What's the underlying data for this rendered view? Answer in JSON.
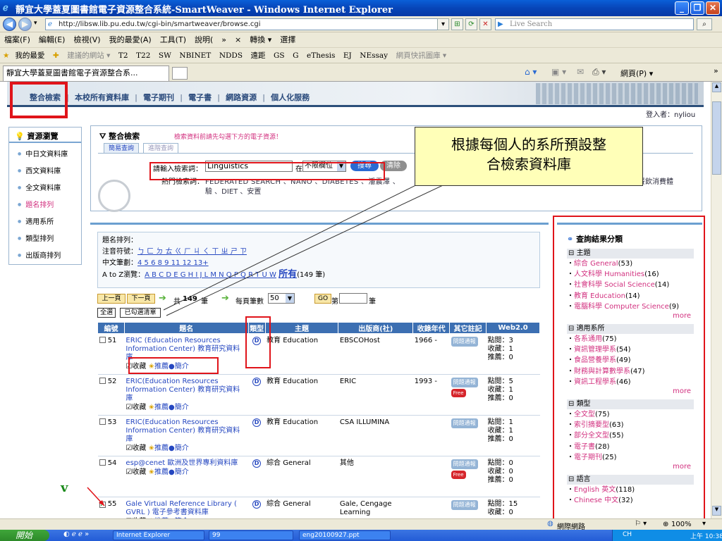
{
  "window": {
    "title": "靜宜大學蓋夏圖書館電子資源整合系統-SmartWeaver - Windows Internet Explorer"
  },
  "address": {
    "url": "http://libsw.lib.pu.edu.tw/cgi-bin/smartweaver/browse.cgi",
    "search_placeholder": "Live Search"
  },
  "menu": [
    "檔案(F)",
    "編輯(E)",
    "檢視(V)",
    "我的最愛(A)",
    "工具(T)",
    "說明(",
    "»",
    "×",
    "轉換 ▾",
    "選擇"
  ],
  "favorites": {
    "label": "我的最愛",
    "items": [
      "建議的網站 ▾",
      "T2",
      "T22",
      "SW",
      "NBINET",
      "NDDS",
      "遠距",
      "GS",
      "G",
      "eThesis",
      "EJ",
      "NEssay",
      "網頁快訊圖庫 ▾"
    ]
  },
  "tab": {
    "title": "靜宜大學蓋夏圖書館電子資源整合系...",
    "page_menu": "網頁(P) ▾"
  },
  "topnav": [
    "整合檢索",
    "本校所有資料庫",
    "電子期刊",
    "電子書",
    "網路資源",
    "個人化服務"
  ],
  "login": "登入者：nyliou",
  "sidebar": {
    "title": "資源瀏覽",
    "items": [
      "中日文資料庫",
      "西文資料庫",
      "全文資料庫",
      "題名排列",
      "適用系所",
      "類型排列",
      "出版商排列"
    ]
  },
  "searchpanel": {
    "title": "整合檢索",
    "notice": "檢索資料前請先勾選下方的電子資源！",
    "tabs": [
      "簡易查詢",
      "進階查詢"
    ],
    "input_label": "請輸入檢索詞：",
    "input_value": "Linguistics",
    "in_label": "在",
    "field_select": "不限欄位",
    "search_btn": "搜尋",
    "clear_btn": "清除",
    "hot_label": "熱門檢索詞：",
    "hot_terms": "FEDERATED SEARCH 、NANO 、DIABETES 、潘震澤 、",
    "hot_terms2": "驗 、DIET 、安置",
    "hot_right": "餐飲消費體"
  },
  "criteria": {
    "heading": "題名排列：",
    "zhuyin_label": "注音符號：",
    "zhuyin": "ㄅ ㄈ ㄉ ㄊ ㄍ ㄏ ㄐ ㄑ ㄒ ㄓ ㄕ ㄗ",
    "strokes_label": "中文筆劃：",
    "strokes": "4 5 6 8 9 11 12 13+",
    "az_label": "A to Z瀏覽：",
    "az": "A B C D E G H I J L M N O P Q R T U W",
    "all_link": "所有",
    "all_count": "(149 筆)"
  },
  "pager": {
    "prev": "上一頁",
    "next": "下一頁",
    "total_prefix": "共",
    "total": "149",
    "total_suffix": "筆",
    "per_page_label": "每頁筆數",
    "per_page": "50",
    "go": "GO",
    "page_prefix": "第",
    "page_suffix": "筆",
    "select_all": "全選",
    "checked": "已勾選清單"
  },
  "table": {
    "headers": [
      "編號",
      "題名",
      "類型",
      "主題",
      "出版商(社)",
      "收錄年代",
      "其它註記",
      "Web2.0"
    ],
    "rows": [
      {
        "num": "51",
        "checked": false,
        "title": "ERIC (Education Resources Information Center) 教育研究資料庫",
        "type": "D",
        "subject": "教育 Education",
        "publisher": "EBSCOHost",
        "year": "1966 -",
        "note": "問題通報",
        "free": "",
        "clicks": "點閱：3",
        "collect": "收藏：1",
        "recommend": "推薦：0"
      },
      {
        "num": "52",
        "checked": false,
        "title": "ERIC(Education Resources Information Center) 教育研究資料庫",
        "type": "D",
        "subject": "教育 Education",
        "publisher": "ERIC",
        "year": "1993 -",
        "note": "問題通報",
        "free": "Free",
        "clicks": "點閱：5",
        "collect": "收藏：1",
        "recommend": "推薦：0"
      },
      {
        "num": "53",
        "checked": false,
        "title": "ERIC(Education Resources Information Center) 教育研究資料庫",
        "type": "D",
        "subject": "教育 Education",
        "publisher": "CSA ILLUMINA",
        "year": "",
        "note": "問題通報",
        "free": "",
        "clicks": "點閱：1",
        "collect": "收藏：1",
        "recommend": "推薦：0"
      },
      {
        "num": "54",
        "checked": false,
        "title": "esp@cenet 歐洲及世界專利資料庫",
        "type": "D",
        "subject": "綜合 General",
        "publisher": "其他",
        "year": "",
        "note": "問題通報",
        "free": "Free",
        "clicks": "點閱：0",
        "collect": "收藏：0",
        "recommend": "推薦：0"
      },
      {
        "num": "55",
        "checked": true,
        "title": "Gale Virtual Reference Library ( GVRL ) 電子參考書資料庫",
        "type": "D",
        "subject": "綜合 General",
        "publisher": "Gale, Cengage Learning",
        "year": "",
        "note": "問題通報",
        "free": "",
        "clicks": "點閱：15",
        "collect": "收藏：0",
        "recommend": ""
      }
    ],
    "actions": {
      "collect": "收藏",
      "recommend": "推薦",
      "intro": "簡介"
    }
  },
  "facets": {
    "title": "查詢結果分類",
    "more": "more",
    "groups": [
      {
        "name": "主題",
        "items": [
          [
            "綜合 General",
            "(53)"
          ],
          [
            "人文科學 Humanities",
            "(16)"
          ],
          [
            "社會科學 Social Science",
            "(14)"
          ],
          [
            "教育 Education",
            "(14)"
          ],
          [
            "電腦科學 Computer Science",
            "(9)"
          ]
        ]
      },
      {
        "name": "適用系所",
        "items": [
          [
            "各系通用",
            "(75)"
          ],
          [
            "資訊管理學系",
            "(54)"
          ],
          [
            "食品營養學系",
            "(49)"
          ],
          [
            "財務與計算數學系",
            "(47)"
          ],
          [
            "資訊工程學系",
            "(46)"
          ]
        ]
      },
      {
        "name": "類型",
        "items": [
          [
            "全文型",
            "(75)"
          ],
          [
            "索引摘要型",
            "(63)"
          ],
          [
            "部分全文型",
            "(55)"
          ],
          [
            "電子書",
            "(28)"
          ],
          [
            "電子期刊",
            "(25)"
          ]
        ]
      },
      {
        "name": "語言",
        "items": [
          [
            "English 英文",
            "(118)"
          ],
          [
            "Chinese 中文",
            "(32)"
          ]
        ]
      }
    ]
  },
  "callout": {
    "line1": "根據每個人的系所預設整",
    "line2": "合檢索資料庫"
  },
  "annotation": {
    "v": "v"
  },
  "status": {
    "zone": "網際網路",
    "zoom": "100%"
  },
  "taskbar": {
    "start": "開始",
    "items": [
      "Internet Explorer",
      "99",
      "eng20100927.ppt"
    ],
    "ime": "CH",
    "time": "上午 10:38"
  },
  "colors": {
    "accent": "#3c6fb2",
    "highlight": "#e0141a",
    "link": "#2547c0",
    "facet_link": "#d2307f"
  }
}
